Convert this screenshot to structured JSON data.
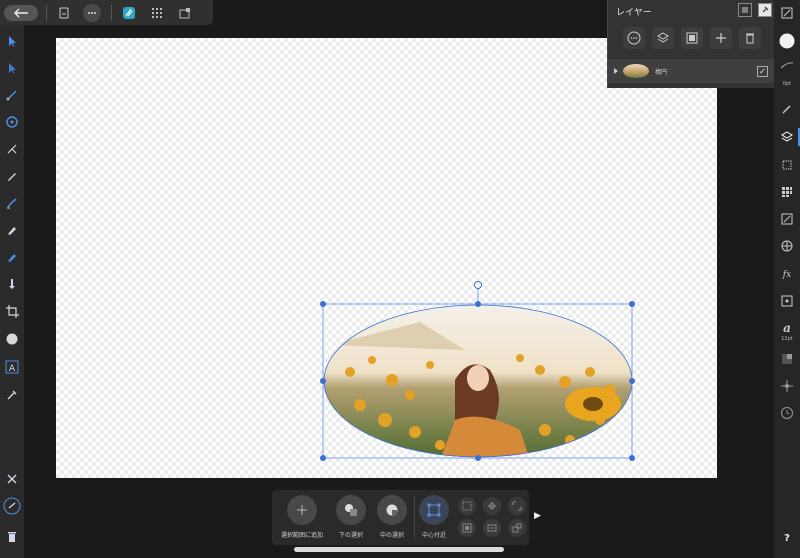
{
  "colors": {
    "accent": "#3b82f6",
    "panel": "#333333",
    "toolbar": "#2b2b2b",
    "workspace": "#1a1a1a"
  },
  "topbar": {
    "icons": [
      "back-arrow-icon",
      "document-icon",
      "more-icon",
      "persona-icon",
      "grid-icon",
      "export-icon"
    ]
  },
  "left_toolbar": {
    "tools": [
      "move-tool-icon",
      "node-tool-icon",
      "corner-tool-icon",
      "point-transform-icon",
      "pen-tool-icon",
      "pencil-tool-icon",
      "vector-brush-icon",
      "fill-tool-icon",
      "transparency-tool-icon",
      "place-image-icon",
      "crop-tool-icon",
      "ellipse-tool-icon",
      "frame-text-tool-icon",
      "color-picker-icon"
    ],
    "bottom": [
      "close-icon",
      "undo-icon",
      "trash-icon"
    ]
  },
  "right_toolbar": {
    "stroke_label": "0pt",
    "font_size_label": "12pt",
    "help_label": "?"
  },
  "layers_panel": {
    "title": "レイヤー",
    "layer": {
      "name": "楕円",
      "checked": "✓"
    }
  },
  "context_toolbar": {
    "items": [
      {
        "label": "選択範囲に追加"
      },
      {
        "label": "下の選択"
      },
      {
        "label": "中の選択"
      },
      {
        "label": "中心付近"
      }
    ],
    "more_label": "▶"
  }
}
